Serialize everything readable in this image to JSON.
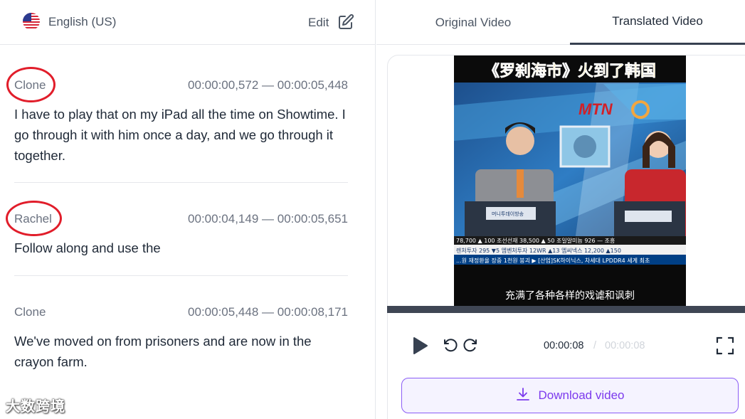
{
  "left_panel": {
    "language": {
      "label": "English (US)",
      "flag_icon": "us-flag-icon"
    },
    "edit_label": "Edit",
    "segments": [
      {
        "speaker": "Clone",
        "time_range": "00:00:00,572 — 00:00:05,448",
        "text": "I have to play that on my iPad all the time on Showtime. I go through it with him once a day, and we go through it together.",
        "highlighted": true
      },
      {
        "speaker": "Rachel",
        "time_range": "00:00:04,149 — 00:00:05,651",
        "text": "Follow along and use the",
        "highlighted": true
      },
      {
        "speaker": "Clone",
        "time_range": "00:00:05,448 — 00:00:08,171",
        "text": "We've moved on from prisoners and are now in the crayon farm.",
        "highlighted": false
      }
    ],
    "watermark": "大数跨境"
  },
  "right_panel": {
    "tabs": [
      {
        "label": "Original Video",
        "active": false
      },
      {
        "label": "Translated Video",
        "active": true
      }
    ],
    "video": {
      "title_overlay": "《罗刹海市》火到了韩国",
      "channel_logo": "MTN",
      "ticker_row_1": "78,700 ▲ 100   조선선재 38,500 ▲ 50   조일알미늄 926 — 조흥",
      "ticker_row_2": "렌처투자 295 ▼5   엠벤처투자 12WR ▲13   엠씨넥스 12,200 ▲150",
      "ticker_row_3": "...원 재정환율 장중 1천원 붕괴 ▶ [산업]SK하이닉스, 차세대 LPDDR4 세계 최초",
      "desk_sign": "머니투데이방송",
      "subtitle": "充满了各种各样的戏谑和讽刺"
    },
    "player": {
      "current_time": "00:00:08",
      "separator": "/",
      "total_time": "00:00:08",
      "progress": 1.0
    },
    "download_label": "Download video"
  },
  "colors": {
    "accent": "#7c3aed",
    "highlight_circle": "#e11d2a",
    "text_muted": "#6b7280"
  }
}
